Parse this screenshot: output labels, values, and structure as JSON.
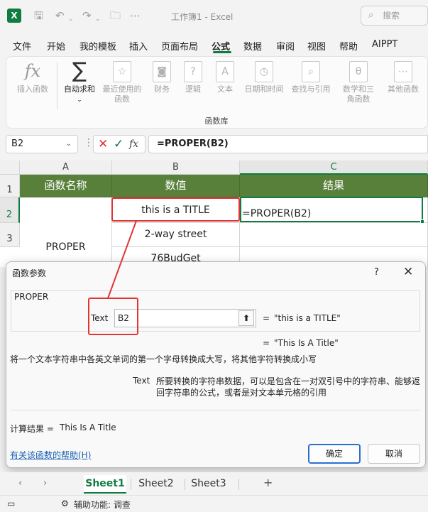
{
  "app": {
    "title": "工作簿1  -  Excel",
    "logo": "X",
    "search_placeholder": "搜索"
  },
  "menu": {
    "items": [
      "文件",
      "开始",
      "我的模板",
      "插入",
      "页面布局",
      "公式",
      "数据",
      "审阅",
      "视图",
      "帮助",
      "AIPPT"
    ],
    "active": "公式"
  },
  "ribbon": {
    "buttons": [
      {
        "label": "插入函数",
        "icon": "fx-icon",
        "glyph": "fx"
      },
      {
        "label": "自动求和",
        "icon": "sigma-icon",
        "glyph": "∑"
      },
      {
        "label": "最近使用的函数",
        "icon": "star-icon",
        "glyph": "☆"
      },
      {
        "label": "财务",
        "icon": "database-icon",
        "glyph": "◙"
      },
      {
        "label": "逻辑",
        "icon": "question-icon",
        "glyph": "?"
      },
      {
        "label": "文本",
        "icon": "text-icon",
        "glyph": "A"
      },
      {
        "label": "日期和时间",
        "icon": "clock-icon",
        "glyph": "◷"
      },
      {
        "label": "查找与引用",
        "icon": "search-icon",
        "glyph": "⌕"
      },
      {
        "label": "数学和三角函数",
        "icon": "theta-icon",
        "glyph": "θ"
      },
      {
        "label": "其他函数",
        "icon": "more-icon",
        "glyph": "⋯"
      }
    ],
    "group_label": "函数库"
  },
  "formula_bar": {
    "name_box": "B2",
    "formula": "=PROPER(B2)",
    "fx": "fx",
    "cancel": "✕",
    "confirm": "✓"
  },
  "grid": {
    "columns": [
      "A",
      "B",
      "C"
    ],
    "rows": [
      "1",
      "2",
      "3"
    ],
    "headers": [
      "函数名称",
      "数值",
      "结果"
    ],
    "a_merged": "PROPER",
    "b_values": [
      "this is a TITLE",
      "2-way street",
      "76BudGet"
    ],
    "c2_formula": "=PROPER(B2)",
    "selected_column": "C",
    "selected_row": "2"
  },
  "dialog": {
    "title": "函数参数",
    "help_glyph": "?",
    "close_glyph": "✕",
    "function_name": "PROPER",
    "arg_label": "Text",
    "arg_value": "B2",
    "arg_btn": "⬆",
    "eq": "=",
    "arg_result": "\"this is a TITLE\"",
    "func_result": "\"This Is A Title\"",
    "description": "将一个文本字符串中各英文单词的第一个字母转换成大写，将其他字符转换成小写",
    "param_name": "Text",
    "param_desc": "所要转换的字符串数据，可以是包含在一对双引号中的字符串、能够返回字符串的公式，或者是对文本单元格的引用",
    "calc_label": "计算结果 =",
    "calc_value": "This Is A Title",
    "help_link": "有关该函数的帮助(H)",
    "ok": "确定",
    "cancel": "取消"
  },
  "sheets": {
    "tabs": [
      "Sheet1",
      "Sheet2",
      "Sheet3"
    ],
    "active": "Sheet1",
    "add": "+",
    "prev": "‹",
    "next": "›"
  },
  "status": {
    "accessibility": "辅助功能: 调查"
  },
  "colors": {
    "accent": "#107c41",
    "header_fill": "#58803a",
    "annotation": "#e03535",
    "link": "#1a5fb4"
  }
}
